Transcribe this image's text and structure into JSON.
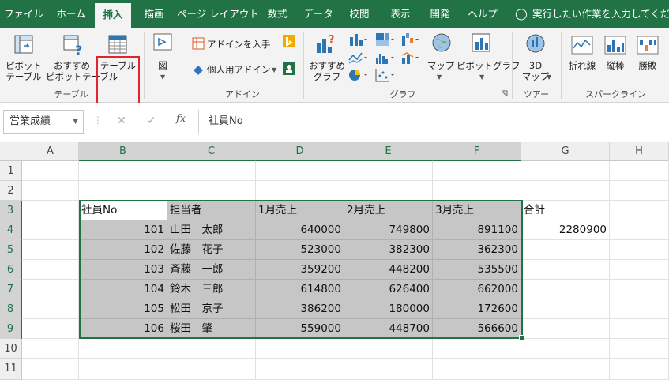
{
  "tabs": [
    "ファイル",
    "ホーム",
    "挿入",
    "描画",
    "ページ レイアウト",
    "数式",
    "データ",
    "校閲",
    "表示",
    "開発",
    "ヘルプ"
  ],
  "active_tab": "挿入",
  "tell_me": "実行したい作業を入力してください",
  "ribbon": {
    "pivot_table": "ピボット\nテーブル",
    "pivot_table_l1": "ピボット",
    "pivot_table_l2": "テーブル",
    "recommended_pivot_l1": "おすすめ",
    "recommended_pivot_l2": "ピボットテーブル",
    "table": "テーブル",
    "group_table": "テーブル",
    "illustrations": "図",
    "get_addins": "アドインを入手",
    "my_addins": "個人用アドイン",
    "group_addins": "アドイン",
    "recommended_charts_l1": "おすすめ",
    "recommended_charts_l2": "グラフ",
    "maps": "マップ",
    "pivot_chart": "ピボットグラフ",
    "group_charts": "グラフ",
    "map3d_l1": "3D",
    "map3d_l2": "マップ",
    "group_tours": "ツアー",
    "sparkline_line": "折れ線",
    "sparkline_column": "縦棒",
    "sparkline_winloss": "勝敗",
    "group_sparklines": "スパークライン"
  },
  "name_box": "営業成績",
  "formula": "社員No",
  "columns": [
    "A",
    "B",
    "C",
    "D",
    "E",
    "F",
    "G",
    "H"
  ],
  "rows": [
    "1",
    "2",
    "3",
    "4",
    "5",
    "6",
    "7",
    "8",
    "9",
    "10",
    "11"
  ],
  "sheet": {
    "header": [
      "社員No",
      "担当者",
      "1月売上",
      "2月売上",
      "3月売上"
    ],
    "total_label": "合計",
    "total_value": "2280900",
    "records": [
      [
        "101",
        "山田　太郎",
        "640000",
        "749800",
        "891100"
      ],
      [
        "102",
        "佐藤　花子",
        "523000",
        "382300",
        "362300"
      ],
      [
        "103",
        "斉藤　一郎",
        "359200",
        "448200",
        "535500"
      ],
      [
        "104",
        "鈴木　三郎",
        "614800",
        "626400",
        "662000"
      ],
      [
        "105",
        "松田　京子",
        "386200",
        "180000",
        "172600"
      ],
      [
        "106",
        "桜田　肇",
        "559000",
        "448700",
        "566600"
      ]
    ]
  },
  "colors": {
    "accent": "#217346",
    "highlight": "#e0262b",
    "selection_fill": "#c6c6c6"
  }
}
